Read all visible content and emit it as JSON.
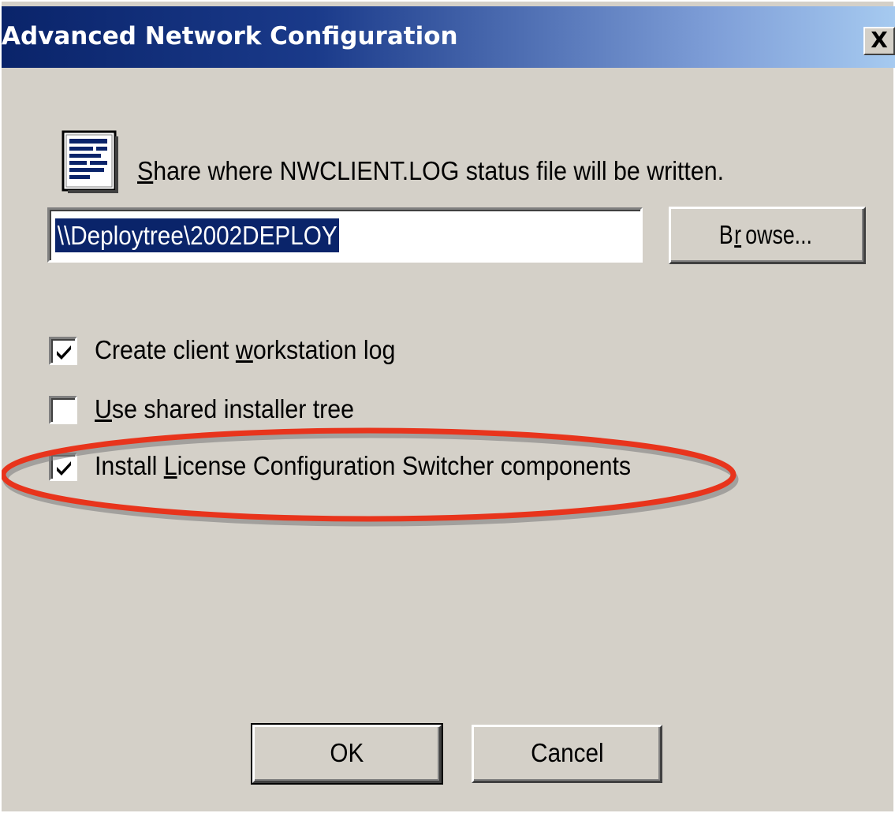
{
  "window": {
    "title": "Advanced Network Configuration",
    "close_label": "X"
  },
  "share": {
    "label_prefix_underlined": "S",
    "label_rest": "hare where NWCLIENT.LOG status file will be written.",
    "path_value": "\\\\Deploytree\\2002DEPLOY",
    "icon": "document-icon"
  },
  "browse_button": {
    "pre": "B",
    "underlined": "r",
    "post": "owse..."
  },
  "options": [
    {
      "pre": "Create client ",
      "underlined": "w",
      "post": "orkstation log",
      "checked": true
    },
    {
      "pre": "",
      "underlined": "U",
      "post": "se shared installer tree",
      "checked": false
    },
    {
      "pre": "Install ",
      "underlined": "L",
      "post": "icense Configuration Switcher components",
      "checked": true
    }
  ],
  "buttons": {
    "ok_label": "OK",
    "cancel_label": "Cancel"
  },
  "colors": {
    "dialog_bg": "#d4d0c8",
    "title_gradient_start": "#0a246a",
    "title_gradient_end": "#a6caf0",
    "selection_bg": "#0a246a",
    "highlight_ellipse": "#e8341c"
  }
}
